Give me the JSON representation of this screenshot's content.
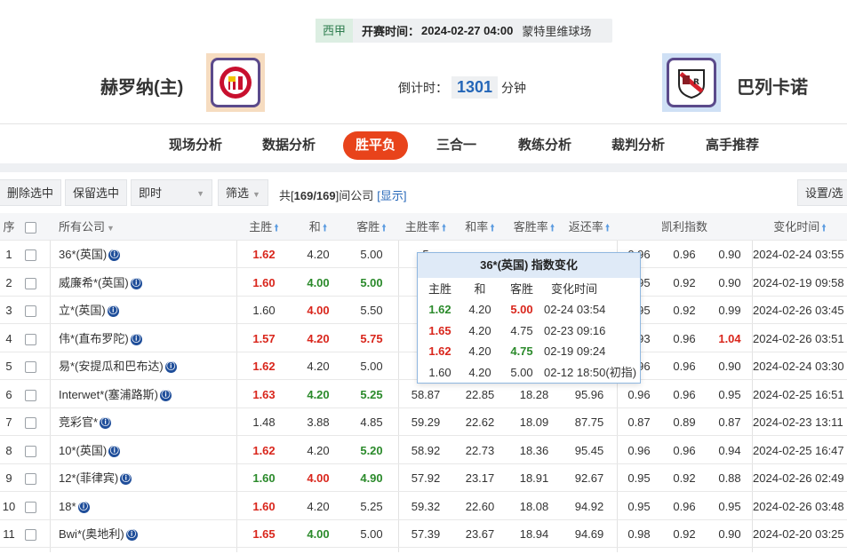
{
  "match": {
    "league": "西甲",
    "kickoff_label": "开赛时间：",
    "kickoff_time": "2024-02-27 04:00",
    "venue": "蒙特里维球场",
    "home": "赫罗纳(主)",
    "away": "巴列卡诺",
    "countdown_label": "倒计时：",
    "countdown_value": "1301",
    "countdown_unit": "分钟"
  },
  "tabs": [
    "现场分析",
    "数据分析",
    "胜平负",
    "三合一",
    "教练分析",
    "裁判分析",
    "高手推荐"
  ],
  "toolbar": {
    "delete_selected": "删除选中",
    "keep_selected": "保留选中",
    "mode": "即时",
    "filter": "筛选",
    "count_prefix": "共[",
    "count_value": "169/169",
    "count_suffix": "]间公司",
    "show_link": "[显示]",
    "settings": "设置/选择"
  },
  "columns": {
    "idx": "序",
    "company": "所有公司",
    "home": "主胜",
    "draw": "和",
    "away": "客胜",
    "home_rate": "主胜率",
    "draw_rate": "和率",
    "away_rate": "客胜率",
    "return_rate": "返还率",
    "kelly": "凯利指数",
    "change_time": "变化时间"
  },
  "rows": [
    {
      "idx": "1",
      "company": "36*(英国)",
      "home": "1.62",
      "home_c": "red",
      "draw": "4.20",
      "draw_c": "plain",
      "away": "5.00",
      "away_c": "plain",
      "hr": "5",
      "dr": "",
      "ar": "",
      "rt": "",
      "k1": "0.96",
      "k2": "0.96",
      "k3": "0.90",
      "k3_c": "plain",
      "time": "2024-02-24 03:55"
    },
    {
      "idx": "2",
      "company": "威廉希*(英国)",
      "home": "1.60",
      "home_c": "red",
      "draw": "4.00",
      "draw_c": "green",
      "away": "5.00",
      "away_c": "green",
      "hr": "5",
      "dr": "",
      "ar": "",
      "rt": "",
      "k1": "0.95",
      "k2": "0.92",
      "k3": "0.90",
      "k3_c": "plain",
      "time": "2024-02-19 09:58"
    },
    {
      "idx": "3",
      "company": "立*(英国)",
      "home": "1.60",
      "home_c": "plain",
      "draw": "4.00",
      "draw_c": "red",
      "away": "5.50",
      "away_c": "plain",
      "hr": "5",
      "dr": "",
      "ar": "",
      "rt": "",
      "k1": "0.95",
      "k2": "0.92",
      "k3": "0.99",
      "k3_c": "plain",
      "time": "2024-02-26 03:45"
    },
    {
      "idx": "4",
      "company": "伟*(直布罗陀)",
      "home": "1.57",
      "home_c": "red",
      "draw": "4.20",
      "draw_c": "red",
      "away": "5.75",
      "away_c": "red",
      "hr": "6",
      "dr": "",
      "ar": "",
      "rt": "",
      "k1": "0.93",
      "k2": "0.96",
      "k3": "1.04",
      "k3_c": "red",
      "time": "2024-02-26 03:51"
    },
    {
      "idx": "5",
      "company": "易*(安提瓜和巴布达)",
      "home": "1.62",
      "home_c": "red",
      "draw": "4.20",
      "draw_c": "plain",
      "away": "5.00",
      "away_c": "plain",
      "hr": "5",
      "dr": "",
      "ar": "",
      "rt": "",
      "k1": "0.96",
      "k2": "0.96",
      "k3": "0.90",
      "k3_c": "plain",
      "time": "2024-02-24 03:30"
    },
    {
      "idx": "6",
      "company": "Interwet*(塞浦路斯)",
      "home": "1.63",
      "home_c": "red",
      "draw": "4.20",
      "draw_c": "green",
      "away": "5.25",
      "away_c": "green",
      "hr": "58.87",
      "dr": "22.85",
      "ar": "18.28",
      "rt": "95.96",
      "k1": "0.96",
      "k2": "0.96",
      "k3": "0.95",
      "k3_c": "plain",
      "time": "2024-02-25 16:51"
    },
    {
      "idx": "7",
      "company": "竞彩官*",
      "home": "1.48",
      "home_c": "plain",
      "draw": "3.88",
      "draw_c": "plain",
      "away": "4.85",
      "away_c": "plain",
      "hr": "59.29",
      "dr": "22.62",
      "ar": "18.09",
      "rt": "87.75",
      "k1": "0.87",
      "k2": "0.89",
      "k3": "0.87",
      "k3_c": "plain",
      "time": "2024-02-23 13:11"
    },
    {
      "idx": "8",
      "company": "10*(英国)",
      "home": "1.62",
      "home_c": "red",
      "draw": "4.20",
      "draw_c": "plain",
      "away": "5.20",
      "away_c": "green",
      "hr": "58.92",
      "dr": "22.73",
      "ar": "18.36",
      "rt": "95.45",
      "k1": "0.96",
      "k2": "0.96",
      "k3": "0.94",
      "k3_c": "plain",
      "time": "2024-02-25 16:47"
    },
    {
      "idx": "9",
      "company": "12*(菲律宾)",
      "home": "1.60",
      "home_c": "green",
      "draw": "4.00",
      "draw_c": "red",
      "away": "4.90",
      "away_c": "green",
      "hr": "57.92",
      "dr": "23.17",
      "ar": "18.91",
      "rt": "92.67",
      "k1": "0.95",
      "k2": "0.92",
      "k3": "0.88",
      "k3_c": "plain",
      "time": "2024-02-26 02:49"
    },
    {
      "idx": "10",
      "company": "18*",
      "home": "1.60",
      "home_c": "red",
      "draw": "4.20",
      "draw_c": "plain",
      "away": "5.25",
      "away_c": "plain",
      "hr": "59.32",
      "dr": "22.60",
      "ar": "18.08",
      "rt": "94.92",
      "k1": "0.95",
      "k2": "0.96",
      "k3": "0.95",
      "k3_c": "plain",
      "time": "2024-02-26 03:48"
    },
    {
      "idx": "11",
      "company": "Bwi*(奥地利)",
      "home": "1.65",
      "home_c": "red",
      "draw": "4.00",
      "draw_c": "green",
      "away": "5.00",
      "away_c": "plain",
      "hr": "57.39",
      "dr": "23.67",
      "ar": "18.94",
      "rt": "94.69",
      "k1": "0.98",
      "k2": "0.92",
      "k3": "0.90",
      "k3_c": "plain",
      "time": "2024-02-20 03:25"
    }
  ],
  "popup": {
    "title": "36*(英国) 指数变化",
    "headers": [
      "主胜",
      "和",
      "客胜",
      "变化时间"
    ],
    "rows": [
      {
        "home": "1.62",
        "home_c": "green",
        "draw": "4.20",
        "draw_c": "plain",
        "away": "5.00",
        "away_c": "red",
        "time": "02-24 03:54"
      },
      {
        "home": "1.65",
        "home_c": "red",
        "draw": "4.20",
        "draw_c": "plain",
        "away": "4.75",
        "away_c": "plain",
        "time": "02-23 09:16"
      },
      {
        "home": "1.62",
        "home_c": "red",
        "draw": "4.20",
        "draw_c": "plain",
        "away": "4.75",
        "away_c": "green",
        "time": "02-19 09:24"
      },
      {
        "home": "1.60",
        "home_c": "plain",
        "draw": "4.20",
        "draw_c": "plain",
        "away": "5.00",
        "away_c": "plain",
        "time": "02-12 18:50(初指)"
      }
    ]
  },
  "icons": {
    "company_badge": "bookmaker-info-icon",
    "sort": "sort-up-arrow-icon"
  },
  "colors": {
    "accent": "#e8431b",
    "up": "#d9261c",
    "down": "#2b8a2b",
    "link": "#2466b8"
  }
}
